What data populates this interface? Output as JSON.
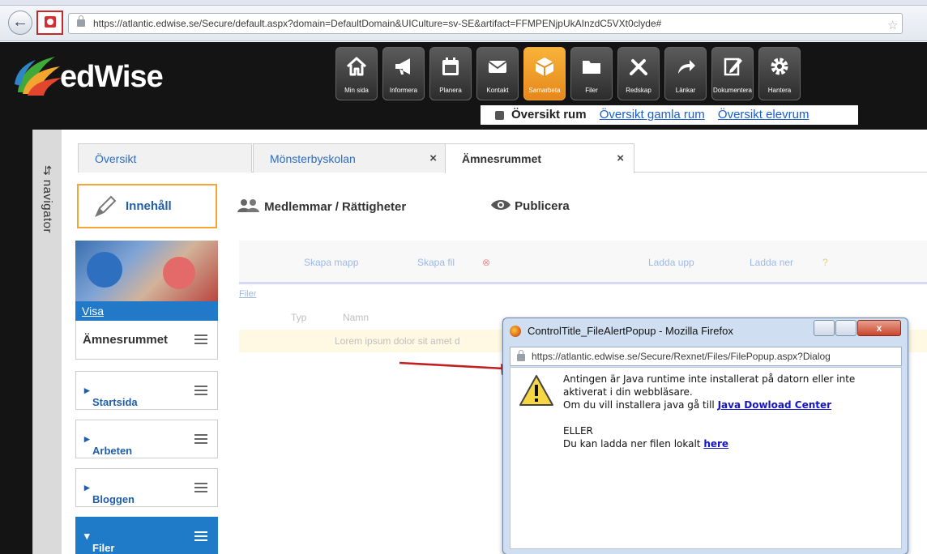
{
  "browser": {
    "url": "https://atlantic.edwise.se/Secure/default.aspx?domain=DefaultDomain&UICulture=sv-SE&artifact=FFMPENjpUkAInzdC5VXt0clyde#"
  },
  "site": {
    "logo_text": "edWise",
    "nav": [
      {
        "label": "Min sida",
        "icon": "home-icon"
      },
      {
        "label": "Informera",
        "icon": "megaphone-icon"
      },
      {
        "label": "Planera",
        "icon": "calendar-icon"
      },
      {
        "label": "Kontakt",
        "icon": "mail-icon"
      },
      {
        "label": "Samarbeta",
        "icon": "cube-icon",
        "selected": true
      },
      {
        "label": "Filer",
        "icon": "folder-icon"
      },
      {
        "label": "Redskap",
        "icon": "tools-icon"
      },
      {
        "label": "Länkar",
        "icon": "share-arrow-icon"
      },
      {
        "label": "Dokumentera",
        "icon": "edit-icon"
      },
      {
        "label": "Hantera",
        "icon": "gear-icon"
      }
    ],
    "subnav": {
      "current": "Översikt rum",
      "links": [
        "Översikt gamla rum",
        "Översikt elevrum"
      ]
    }
  },
  "sidebar": {
    "label": "navigator",
    "toggle": "⇆"
  },
  "tabs": [
    {
      "label": "Översikt",
      "closable": false
    },
    {
      "label": "Mönsterbyskolan",
      "closable": true
    },
    {
      "label": "Ämnesrummet",
      "closable": true,
      "active": true
    }
  ],
  "tab_close": "×",
  "sections": {
    "innehall": "Innehåll",
    "members": "Medlemmar / Rättigheter",
    "publish": "Publicera"
  },
  "left": {
    "visa": "Visa",
    "room": "Ämnesrummet",
    "items": [
      {
        "label": "Startsida"
      },
      {
        "label": "Arbeten"
      },
      {
        "label": "Bloggen"
      },
      {
        "label": "Filer",
        "selected": true
      }
    ]
  },
  "filemanager": {
    "toolbar": [
      "Skapa mapp",
      "Skapa fil",
      "Ladda upp",
      "Ladda ner",
      "?"
    ],
    "crumb": "Filer",
    "columns": [
      "Typ",
      "Namn"
    ],
    "row": "Lorem ipsum dolor sit amet d"
  },
  "popup": {
    "title": "ControlTitle_FileAlertPopup - Mozilla Firefox",
    "url": "https://atlantic.edwise.se/Secure/Rexnet/Files/FilePopup.aspx?Dialog",
    "line1": "Antingen är Java runtime inte installerat på datorn eller inte aktiverat i din webbläsare.",
    "line2": "Om du vill installera java gå till",
    "link1": "Java Dowload Center",
    "line3": "ELLER",
    "line4": "Du kan ladda ner filen lokalt",
    "link2": "here"
  },
  "colors": {
    "accent": "#f4a536",
    "brand_blue": "#1f7ac8",
    "header": "#141414"
  }
}
